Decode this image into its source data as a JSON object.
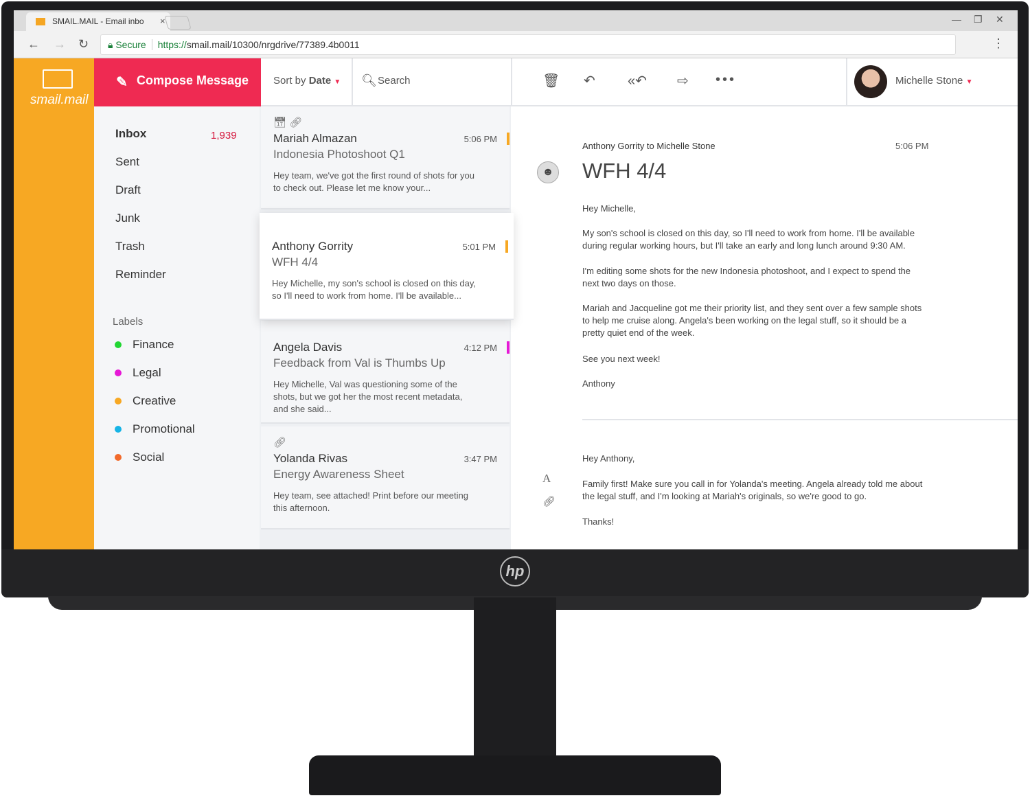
{
  "browser": {
    "tab_title": "SMAIL.MAIL - Email inbo",
    "secure_label": "Secure",
    "url_scheme": "https://",
    "url_rest": "smail.mail/10300/nrgdrive/77389.4b0011"
  },
  "app": {
    "logo_text": "smail.mail",
    "compose_label": "Compose Message",
    "sort_prefix": "Sort by",
    "sort_value": "Date",
    "search_placeholder": "Search",
    "user_name": "Michelle Stone"
  },
  "sidebar": {
    "folders": [
      {
        "label": "Inbox",
        "count": "1,939"
      },
      {
        "label": "Sent"
      },
      {
        "label": "Draft"
      },
      {
        "label": "Junk"
      },
      {
        "label": "Trash"
      },
      {
        "label": "Reminder"
      }
    ],
    "labels_heading": "Labels",
    "labels": [
      {
        "label": "Finance",
        "color": "#22d633"
      },
      {
        "label": "Legal",
        "color": "#e619d6"
      },
      {
        "label": "Creative",
        "color": "#f7a823"
      },
      {
        "label": "Promotional",
        "color": "#17b4e6"
      },
      {
        "label": "Social",
        "color": "#f26a2b"
      }
    ]
  },
  "emails": [
    {
      "from": "Mariah Almazan",
      "subject": "Indonesia Photoshoot Q1",
      "time": "5:06 PM",
      "preview": "Hey team, we've got the first round of shots for you to check out. Please let me know your...",
      "flag": "#f7a823",
      "icons": [
        "calendar-icon",
        "link-icon"
      ]
    },
    {
      "from": "Anthony Gorrity",
      "subject": "WFH 4/4",
      "time": "5:01 PM",
      "preview": "Hey Michelle, my son's school is closed on this day, so I'll need to work from home. I'll be available...",
      "flag": "#f7a823",
      "selected": true
    },
    {
      "from": "Angela Davis",
      "subject": "Feedback from Val is Thumbs Up",
      "time": "4:12 PM",
      "preview": "Hey Michelle, Val was questioning some of the shots, but we got her the most recent metadata, and she said...",
      "flag": "#e619d6"
    },
    {
      "from": "Yolanda Rivas",
      "subject": "Energy Awareness Sheet",
      "time": "3:47 PM",
      "preview": "Hey team, see attached! Print before our meeting this afternoon.",
      "icons": [
        "link-icon"
      ]
    }
  ],
  "reader": {
    "meta": "Anthony Gorrity to Michelle Stone",
    "time": "5:06 PM",
    "title": "WFH 4/4",
    "body": [
      "Hey Michelle,",
      "My son's school is closed on this day, so I'll need to work from home. I'll be available during regular working hours, but I'll take an early and long lunch around 9:30 AM.",
      "I'm editing some shots for the new Indonesia photoshoot, and I expect to spend the next two days on those.",
      "Mariah and Jacqueline got me their priority list, and they sent over a few sample shots to help me cruise along. Angela's been working on the legal stuff, so it should be a pretty quiet end of the week.",
      "See you next week!",
      "Anthony"
    ],
    "reply": [
      "Hey Anthony,",
      "Family first! Make sure you call in for Yolanda's meeting. Angela already told me about the legal stuff, and I'm looking at Mariah's originals, so we're good to go.",
      "Thanks!"
    ]
  },
  "monitor": {
    "brand": "hp"
  }
}
